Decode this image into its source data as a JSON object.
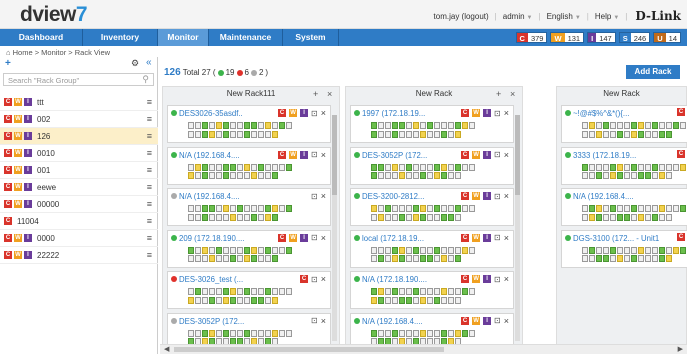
{
  "app": {
    "logo_text": "dview",
    "logo_seven": "7"
  },
  "user_bar": {
    "user": "tom.jay (logout)",
    "admin": "admin",
    "language": "English",
    "help": "Help",
    "brand": "D-Link"
  },
  "nav": {
    "dashboard": "Dashboard",
    "inventory": "Inventory",
    "monitor": "Monitor",
    "maintenance": "Maintenance",
    "system": "System"
  },
  "alarm_badges": [
    {
      "key": "C",
      "value": "379",
      "color": "#d9342b"
    },
    {
      "key": "W",
      "value": "131",
      "color": "#f0a020"
    },
    {
      "key": "I",
      "value": "147",
      "color": "#6a3c9a"
    },
    {
      "key": "S",
      "value": "246",
      "color": "#2f7cc6"
    },
    {
      "key": "U",
      "value": "14",
      "color": "#c06a1a"
    }
  ],
  "breadcrumb": "Home > Monitor > Rack View",
  "sidebar": {
    "search_placeholder": "Search \"Rack Group\"",
    "groups": [
      {
        "label": "ttt",
        "icons": [
          "C",
          "W",
          "I"
        ]
      },
      {
        "label": "002",
        "icons": [
          "C",
          "W",
          "I"
        ]
      },
      {
        "label": "126",
        "icons": [
          "C",
          "W",
          "I"
        ],
        "selected": true
      },
      {
        "label": "0010",
        "icons": [
          "C",
          "W",
          "I"
        ]
      },
      {
        "label": "001",
        "icons": [
          "C",
          "W",
          "I"
        ]
      },
      {
        "label": "eewe",
        "icons": [
          "C",
          "W",
          "I"
        ]
      },
      {
        "label": "00000",
        "icons": [
          "C",
          "W",
          "I"
        ]
      },
      {
        "label": "11004",
        "icons": [
          "C"
        ]
      },
      {
        "label": "0000",
        "icons": [
          "C",
          "W",
          "I"
        ]
      },
      {
        "label": "22222",
        "icons": [
          "C",
          "W",
          "I"
        ]
      }
    ]
  },
  "summary": {
    "count": "126",
    "total_label": "Total 27 (",
    "green": "19",
    "red": "6",
    "gray": "2",
    "close": ")"
  },
  "add_rack_label": "Add Rack",
  "racks": [
    {
      "title": "New Rack111",
      "devices": [
        {
          "name": "DES3026-35asdf..",
          "status": "green",
          "icons": [
            "C",
            "W",
            "I"
          ]
        },
        {
          "name": "N/A (192.168.4....",
          "status": "green",
          "icons": [
            "C",
            "W",
            "I"
          ]
        },
        {
          "name": "N/A (192.168.4....",
          "status": "gray",
          "icons": []
        },
        {
          "name": "209 (172.18.190....",
          "status": "green",
          "icons": [
            "C",
            "W",
            "I"
          ]
        },
        {
          "name": "DES-3026_test (...",
          "status": "red",
          "icons": [
            "C"
          ]
        },
        {
          "name": "DES-3052P (172...",
          "status": "gray",
          "icons": []
        }
      ]
    },
    {
      "title": "New Rack",
      "devices": [
        {
          "name": "1997 (172.18.19...",
          "status": "green",
          "icons": [
            "C",
            "W",
            "I"
          ]
        },
        {
          "name": "DES-3052P (172...",
          "status": "green",
          "icons": [
            "C",
            "W",
            "I"
          ]
        },
        {
          "name": "DES-3200-2812...",
          "status": "green",
          "icons": [
            "C",
            "W",
            "I"
          ]
        },
        {
          "name": "local (172.18.19...",
          "status": "green",
          "icons": [
            "C",
            "W",
            "I"
          ]
        },
        {
          "name": "N/A (172.18.190....",
          "status": "green",
          "icons": [
            "C",
            "W",
            "I"
          ]
        },
        {
          "name": "N/A (192.168.4....",
          "status": "green",
          "icons": [
            "C",
            "W",
            "I"
          ]
        }
      ]
    },
    {
      "title": "New Rack",
      "devices": [
        {
          "name": "~!@#$%^&*(){...",
          "status": "green",
          "icons": [
            "C"
          ]
        },
        {
          "name": "3333 (172.18.19...",
          "status": "green",
          "icons": [
            "C"
          ]
        },
        {
          "name": "N/A (192.168.4....",
          "status": "green",
          "icons": []
        },
        {
          "name": "DGS-3100 (172... - Unit1",
          "status": "green",
          "icons": [
            "C"
          ]
        }
      ]
    }
  ],
  "colors": {
    "green": "#3cb44b",
    "red": "#e0312b",
    "gray": "#aaaaaa",
    "accent": "#2f7cc6"
  }
}
